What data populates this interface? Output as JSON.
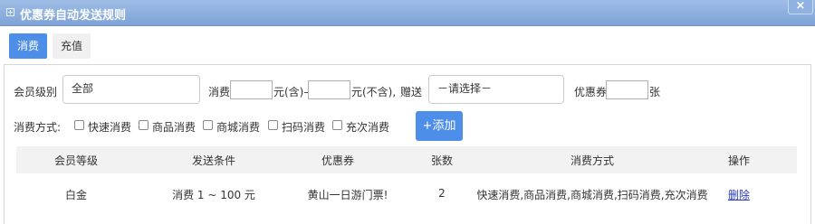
{
  "window": {
    "title": "优惠券自动发送规则",
    "close_label": "×"
  },
  "tabs": [
    {
      "label": "消费",
      "active": true
    },
    {
      "label": "充值",
      "active": false
    }
  ],
  "form": {
    "member_level_label": "会员级别",
    "member_level_value": "全部",
    "consume_label": "消费",
    "yuan_incl": "元(含)–",
    "yuan_excl": "元(不含),",
    "gift_label": "赠送",
    "gift_value": "－请选择－",
    "coupon_label": "优惠券",
    "coupon_unit": "张",
    "consume_mode_label": "消费方式:",
    "modes": [
      "快速消费",
      "商品消费",
      "商城消费",
      "扫码消费",
      "充次消费"
    ],
    "add_button": "+添加"
  },
  "table": {
    "columns": [
      "会员等级",
      "发送条件",
      "优惠券",
      "张数",
      "消费方式",
      "操作"
    ],
    "rows": [
      {
        "level": "白金",
        "condition": "消费 1 ~ 100 元",
        "coupon": "黄山一日游门票!",
        "count": "2",
        "modes": "快速消费,商品消费,商城消费,扫码消费,充次消费",
        "action": "删除"
      }
    ]
  },
  "colors": {
    "titlebar": "#8eb0df",
    "accent": "#4d8ee8",
    "link": "#2a3bb8"
  }
}
